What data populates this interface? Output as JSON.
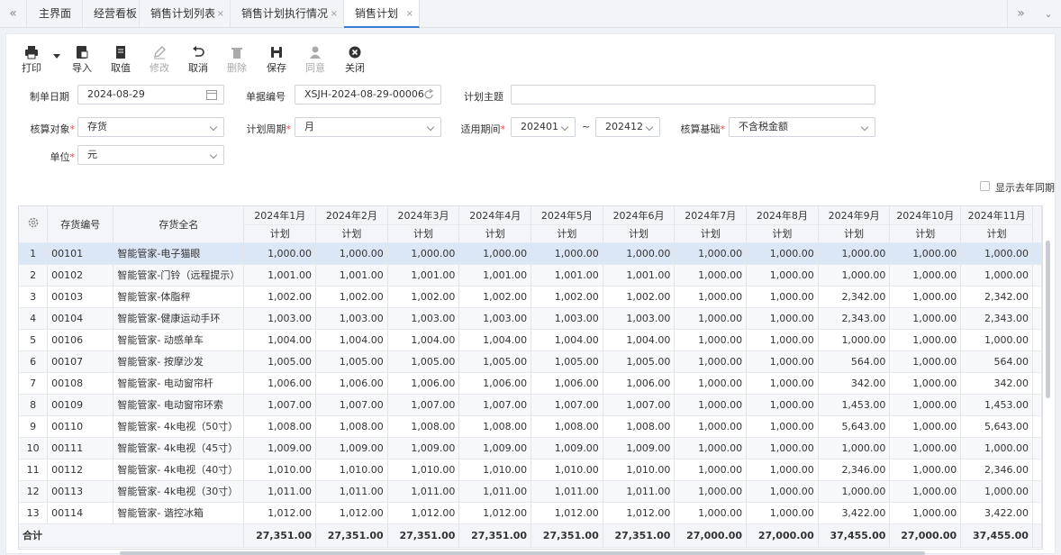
{
  "tabs": [
    "主界面",
    "经营看板",
    "销售计划列表",
    "销售计划执行情况",
    "销售计划"
  ],
  "toolbar": {
    "print": "打印",
    "import": "导入",
    "fetch": "取值",
    "edit": "修改",
    "cancel": "取消",
    "delete": "删除",
    "save": "保存",
    "approve": "同意",
    "close": "关闭"
  },
  "form": {
    "date_label": "制单日期",
    "date_value": "2024-08-29",
    "code_label": "单据编号",
    "code_value": "XSJH-2024-08-29-00006",
    "topic_label": "计划主题",
    "topic_value": "",
    "target_label": "核算对象",
    "target_value": "存货",
    "period_label": "计划周期",
    "period_value": "月",
    "range_label": "适用期间",
    "range_from": "202401",
    "range_sep": "~",
    "range_to": "202412",
    "basis_label": "核算基础",
    "basis_value": "不含税金额",
    "unit_label": "单位",
    "unit_value": "元",
    "show_last_year": "显示去年同期"
  },
  "table": {
    "col_code": "存货编号",
    "col_name": "存货全名",
    "months": [
      "2024年1月",
      "2024年2月",
      "2024年3月",
      "2024年4月",
      "2024年5月",
      "2024年6月",
      "2024年7月",
      "2024年8月",
      "2024年9月",
      "2024年10月",
      "2024年11月"
    ],
    "sub": "计划",
    "rows": [
      {
        "idx": "1",
        "code": "00101",
        "name": "智能管家-电子猫眼",
        "vals": [
          "1,000.00",
          "1,000.00",
          "1,000.00",
          "1,000.00",
          "1,000.00",
          "1,000.00",
          "1,000.00",
          "1,000.00",
          "1,000.00",
          "1,000.00",
          "1,000.00"
        ]
      },
      {
        "idx": "2",
        "code": "00102",
        "name": "智能管家-门铃（远程提示）",
        "vals": [
          "1,001.00",
          "1,001.00",
          "1,001.00",
          "1,001.00",
          "1,001.00",
          "1,001.00",
          "1,000.00",
          "1,000.00",
          "1,000.00",
          "1,000.00",
          "1,000.00"
        ]
      },
      {
        "idx": "3",
        "code": "00103",
        "name": "智能管家-体脂秤",
        "vals": [
          "1,002.00",
          "1,002.00",
          "1,002.00",
          "1,002.00",
          "1,002.00",
          "1,002.00",
          "1,000.00",
          "1,000.00",
          "2,342.00",
          "1,000.00",
          "2,342.00"
        ]
      },
      {
        "idx": "4",
        "code": "00104",
        "name": "智能管家-健康运动手环",
        "vals": [
          "1,003.00",
          "1,003.00",
          "1,003.00",
          "1,003.00",
          "1,003.00",
          "1,003.00",
          "1,000.00",
          "1,000.00",
          "2,343.00",
          "1,000.00",
          "2,343.00"
        ]
      },
      {
        "idx": "5",
        "code": "00106",
        "name": "智能管家- 动感单车",
        "vals": [
          "1,004.00",
          "1,004.00",
          "1,004.00",
          "1,004.00",
          "1,004.00",
          "1,004.00",
          "1,000.00",
          "1,000.00",
          "1,000.00",
          "1,000.00",
          "1,000.00"
        ]
      },
      {
        "idx": "6",
        "code": "00107",
        "name": "智能管家- 按摩沙发",
        "vals": [
          "1,005.00",
          "1,005.00",
          "1,005.00",
          "1,005.00",
          "1,005.00",
          "1,005.00",
          "1,000.00",
          "1,000.00",
          "564.00",
          "1,000.00",
          "564.00"
        ]
      },
      {
        "idx": "7",
        "code": "00108",
        "name": "智能管家- 电动窗帘杆",
        "vals": [
          "1,006.00",
          "1,006.00",
          "1,006.00",
          "1,006.00",
          "1,006.00",
          "1,006.00",
          "1,000.00",
          "1,000.00",
          "342.00",
          "1,000.00",
          "342.00"
        ]
      },
      {
        "idx": "8",
        "code": "00109",
        "name": "智能管家- 电动窗帘环索",
        "vals": [
          "1,007.00",
          "1,007.00",
          "1,007.00",
          "1,007.00",
          "1,007.00",
          "1,007.00",
          "1,000.00",
          "1,000.00",
          "1,453.00",
          "1,000.00",
          "1,453.00"
        ]
      },
      {
        "idx": "9",
        "code": "00110",
        "name": "智能管家- 4k电视（50寸）",
        "vals": [
          "1,008.00",
          "1,008.00",
          "1,008.00",
          "1,008.00",
          "1,008.00",
          "1,008.00",
          "1,000.00",
          "1,000.00",
          "5,643.00",
          "1,000.00",
          "5,643.00"
        ]
      },
      {
        "idx": "10",
        "code": "00111",
        "name": "智能管家- 4k电视（45寸）",
        "vals": [
          "1,009.00",
          "1,009.00",
          "1,009.00",
          "1,009.00",
          "1,009.00",
          "1,009.00",
          "1,000.00",
          "1,000.00",
          "1,000.00",
          "1,000.00",
          "1,000.00"
        ]
      },
      {
        "idx": "11",
        "code": "00112",
        "name": "智能管家- 4k电视（40寸）",
        "vals": [
          "1,010.00",
          "1,010.00",
          "1,010.00",
          "1,010.00",
          "1,010.00",
          "1,010.00",
          "1,000.00",
          "1,000.00",
          "2,346.00",
          "1,000.00",
          "2,346.00"
        ]
      },
      {
        "idx": "12",
        "code": "00113",
        "name": "智能管家- 4k电视（30寸）",
        "vals": [
          "1,011.00",
          "1,011.00",
          "1,011.00",
          "1,011.00",
          "1,011.00",
          "1,011.00",
          "1,000.00",
          "1,000.00",
          "1,000.00",
          "1,000.00",
          "1,000.00"
        ]
      },
      {
        "idx": "13",
        "code": "00114",
        "name": "智能管家- 谐控冰箱",
        "vals": [
          "1,012.00",
          "1,012.00",
          "1,012.00",
          "1,012.00",
          "1,012.00",
          "1,012.00",
          "1,000.00",
          "1,000.00",
          "3,422.00",
          "1,000.00",
          "3,422.00"
        ]
      }
    ],
    "total_label": "合计",
    "totals": [
      "27,351.00",
      "27,351.00",
      "27,351.00",
      "27,351.00",
      "27,351.00",
      "27,351.00",
      "27,000.00",
      "27,000.00",
      "37,455.00",
      "27,000.00",
      "37,455.00"
    ]
  }
}
